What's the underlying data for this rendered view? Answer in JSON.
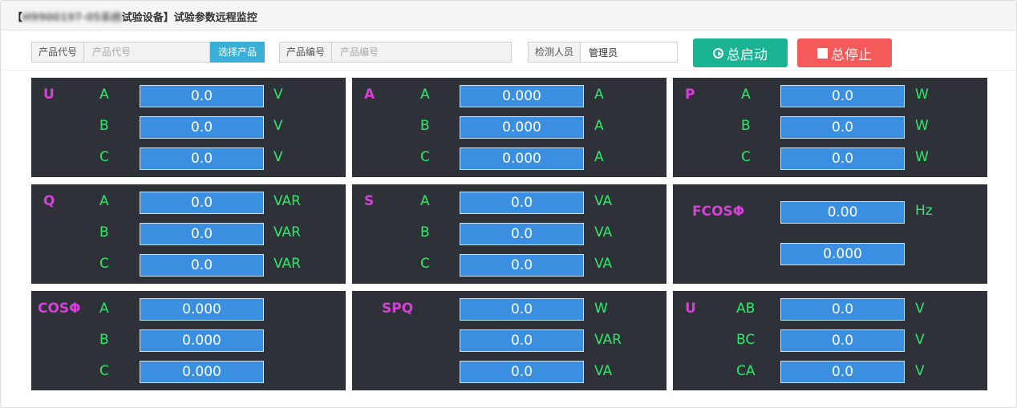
{
  "window": {
    "title_prefix": "【",
    "title_blurred": "H9900197-05系统",
    "title_rest": "试验设备】试验参数远程监控"
  },
  "toolbar": {
    "product_code_label": "产品代号",
    "product_code_placeholder": "产品代号",
    "select_product_label": "选择产品",
    "product_number_label": "产品编号",
    "product_number_placeholder": "产品编号",
    "inspector_label": "检测人员",
    "inspector_value": "管理员",
    "start_label": "总启动",
    "stop_label": "总停止"
  },
  "colors": {
    "panel_bg": "#2e3238",
    "value_bg": "#3a8fe0",
    "param_label": "#d640d6",
    "unit_label": "#2ee86a",
    "start": "#1ab394",
    "stop": "#f55a5a"
  },
  "panels": [
    {
      "label": "U",
      "rows": [
        {
          "phase": "A",
          "value": "0.0",
          "unit": "V"
        },
        {
          "phase": "B",
          "value": "0.0",
          "unit": "V"
        },
        {
          "phase": "C",
          "value": "0.0",
          "unit": "V"
        }
      ]
    },
    {
      "label": "A",
      "rows": [
        {
          "phase": "A",
          "value": "0.000",
          "unit": "A"
        },
        {
          "phase": "B",
          "value": "0.000",
          "unit": "A"
        },
        {
          "phase": "C",
          "value": "0.000",
          "unit": "A"
        }
      ]
    },
    {
      "label": "P",
      "rows": [
        {
          "phase": "A",
          "value": "0.0",
          "unit": "W"
        },
        {
          "phase": "B",
          "value": "0.0",
          "unit": "W"
        },
        {
          "phase": "C",
          "value": "0.0",
          "unit": "W"
        }
      ]
    },
    {
      "label": "Q",
      "rows": [
        {
          "phase": "A",
          "value": "0.0",
          "unit": "VAR"
        },
        {
          "phase": "B",
          "value": "0.0",
          "unit": "VAR"
        },
        {
          "phase": "C",
          "value": "0.0",
          "unit": "VAR"
        }
      ]
    },
    {
      "label": "S",
      "rows": [
        {
          "phase": "A",
          "value": "0.0",
          "unit": "VA"
        },
        {
          "phase": "B",
          "value": "0.0",
          "unit": "VA"
        },
        {
          "phase": "C",
          "value": "0.0",
          "unit": "VA"
        }
      ]
    },
    {
      "label": "FCOSΦ",
      "rows": [
        {
          "value": "0.00",
          "unit": "Hz"
        },
        {
          "value": "0.000"
        }
      ]
    },
    {
      "label": "COSΦ",
      "rows": [
        {
          "phase": "A",
          "value": "0.000"
        },
        {
          "phase": "B",
          "value": "0.000"
        },
        {
          "phase": "C",
          "value": "0.000"
        }
      ]
    },
    {
      "label": "SPQ",
      "rows": [
        {
          "value": "0.0",
          "unit": "W"
        },
        {
          "value": "0.0",
          "unit": "VAR"
        },
        {
          "value": "0.0",
          "unit": "VA"
        }
      ]
    },
    {
      "label": "U",
      "rows": [
        {
          "phase": "AB",
          "value": "0.0",
          "unit": "V"
        },
        {
          "phase": "BC",
          "value": "0.0",
          "unit": "V"
        },
        {
          "phase": "CA",
          "value": "0.0",
          "unit": "V"
        }
      ]
    }
  ]
}
